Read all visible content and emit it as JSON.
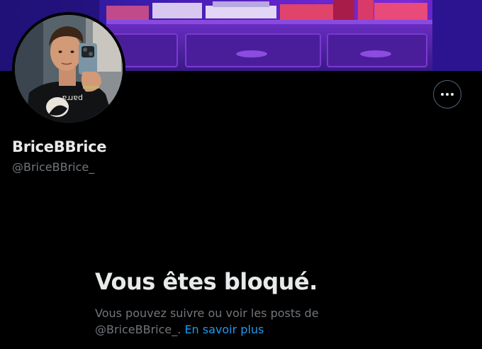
{
  "profile": {
    "display_name": "BriceBBrice",
    "handle": "@BriceBBrice_",
    "banner_description_icon": "banner-image",
    "avatar_icon": "avatar-photo",
    "shirt_text": "parra"
  },
  "actions": {
    "more_icon": "more-horizontal-icon"
  },
  "blocked": {
    "title": "Vous êtes bloqué.",
    "desc_prefix": "Vous pouvez suivre ou voir les posts de",
    "desc_handle": "@BriceBBrice_.",
    "learn_more": "En savoir plus"
  },
  "colors": {
    "background": "#000000",
    "text_primary": "#e7e9ea",
    "text_secondary": "#71767b",
    "link": "#1d9bf0",
    "border": "#536471"
  }
}
